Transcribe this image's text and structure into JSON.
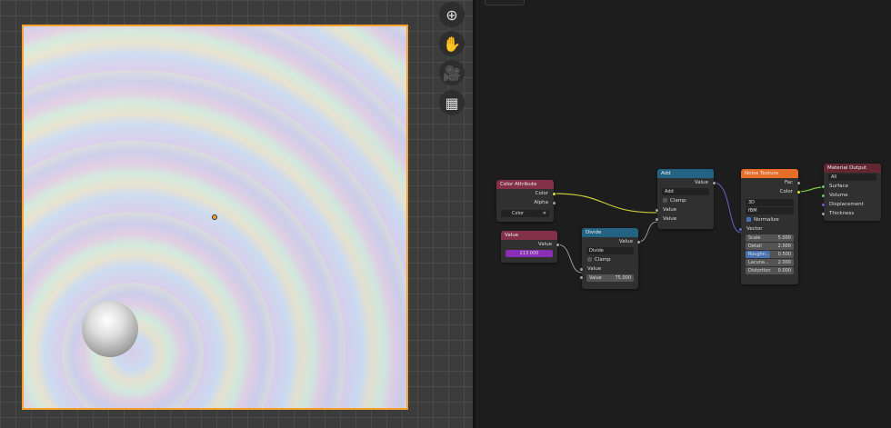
{
  "viewport": {
    "tools": [
      "zoom-icon",
      "hand-icon",
      "camera-icon",
      "grid-icon"
    ]
  },
  "nodes": {
    "color_attribute": {
      "title": "Color Attribute",
      "out_color": "Color",
      "out_alpha": "Alpha",
      "attribute": "Color",
      "clear": "✕"
    },
    "value": {
      "title": "Value",
      "out": "Value",
      "value": "213.000"
    },
    "divide": {
      "title": "Divide",
      "out": "Value",
      "operation": "Divide",
      "clamp": "Clamp",
      "in_value": "Value",
      "field_label": "Value",
      "field_value": "75.000"
    },
    "add": {
      "title": "Add",
      "out": "Value",
      "operation": "Add",
      "clamp": "Clamp",
      "in1": "Value",
      "in2": "Value"
    },
    "noise": {
      "title": "Noise Texture",
      "out_fac": "Fac",
      "out_color": "Color",
      "dims": "3D",
      "type": "fBM",
      "normalize": "Normalize",
      "vector": "Vector",
      "fields": [
        {
          "label": "Scale",
          "value": "5.000"
        },
        {
          "label": "Detail",
          "value": "2.000"
        },
        {
          "label": "Roughn...",
          "value": "0.500"
        },
        {
          "label": "Lacuna...",
          "value": "2.000"
        },
        {
          "label": "Distortion",
          "value": "0.000"
        }
      ],
      "roughness_fill": 0.5
    },
    "output": {
      "title": "Material Output",
      "target": "All",
      "inputs": [
        "Surface",
        "Volume",
        "Displacement",
        "Thickness"
      ]
    }
  },
  "colors": {
    "accent": "#f5a02a",
    "input_header": "#83314a",
    "converter_header": "#246283",
    "texture_header": "#e66e28",
    "output_header": "#632732",
    "value_field": "#8a2fb5"
  }
}
